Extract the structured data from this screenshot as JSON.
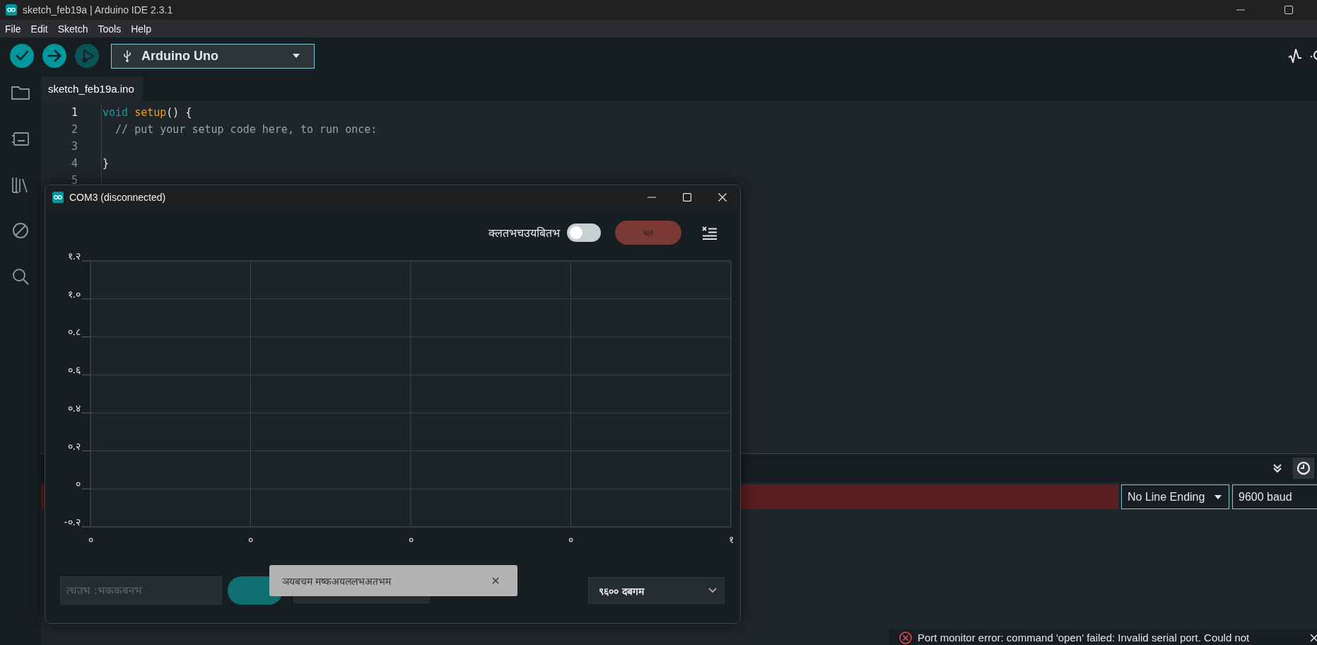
{
  "window": {
    "title": "sketch_feb19a | Arduino IDE 2.3.1"
  },
  "menu": [
    "File",
    "Edit",
    "Sketch",
    "Tools",
    "Help"
  ],
  "toolbar": {
    "buttons": [
      {
        "kind": "verify",
        "disabled": false
      },
      {
        "kind": "upload",
        "disabled": false
      },
      {
        "kind": "debug",
        "disabled": true
      }
    ],
    "board": "Arduino Uno"
  },
  "sidebar": {
    "items": [
      {
        "kind": "folder"
      },
      {
        "kind": "board"
      },
      {
        "kind": "library"
      },
      {
        "kind": "debug"
      },
      {
        "kind": "search"
      }
    ]
  },
  "tabs": [
    {
      "label": "sketch_feb19a.ino",
      "selected": true
    }
  ],
  "editor": {
    "lines": [
      {
        "number": "1",
        "active": true,
        "tokens": [
          {
            "kind": "keyword",
            "text": "void "
          },
          {
            "kind": "function",
            "text": "setup"
          },
          {
            "kind": "plain",
            "text": "() {"
          }
        ]
      },
      {
        "number": "2",
        "active": false,
        "tokens": [
          {
            "kind": "comment",
            "text": "  // put your setup code here, to run once:"
          }
        ]
      },
      {
        "number": "3",
        "active": false
      },
      {
        "number": "4",
        "active": false,
        "tokens": [
          {
            "kind": "plain",
            "text": "}"
          }
        ]
      },
      {
        "number": "5",
        "active": false
      }
    ]
  },
  "serial_monitor": {
    "message_error": true,
    "line_ending": "No Line Ending",
    "baud": "9600 baud"
  },
  "notification": {
    "kind": "error",
    "text": "Port monitor error: command 'open' failed: Invalid serial port. Could not"
  },
  "plotter": {
    "title": "COM3 (disconnected)",
    "interpolate_label": "क्लतभचउयबितभ",
    "interpolate_on": false,
    "connect_button": "च्ल",
    "chart_data": {
      "type": "line",
      "grid": true,
      "ylim": [
        -0.2,
        1.2
      ],
      "categories": [
        "०",
        "०",
        "०",
        "०",
        "१"
      ],
      "yticks": [
        {
          "value": 1.2,
          "label": "१.२"
        },
        {
          "value": 1,
          "label": "१.०"
        },
        {
          "value": 0.8,
          "label": "०.८"
        },
        {
          "value": 0.6,
          "label": "०.६"
        },
        {
          "value": 0.4,
          "label": "०.४"
        },
        {
          "value": 0.2,
          "label": "०.२"
        },
        {
          "value": 0,
          "label": "०"
        },
        {
          "value": -0.2,
          "label": "-०.२"
        }
      ]
    },
    "message_placeholder": "त्थउभ :भककबनभ",
    "baud": "९६०० दबगम",
    "toast": "ञयबचम मष्कअयललभअतभम"
  }
}
